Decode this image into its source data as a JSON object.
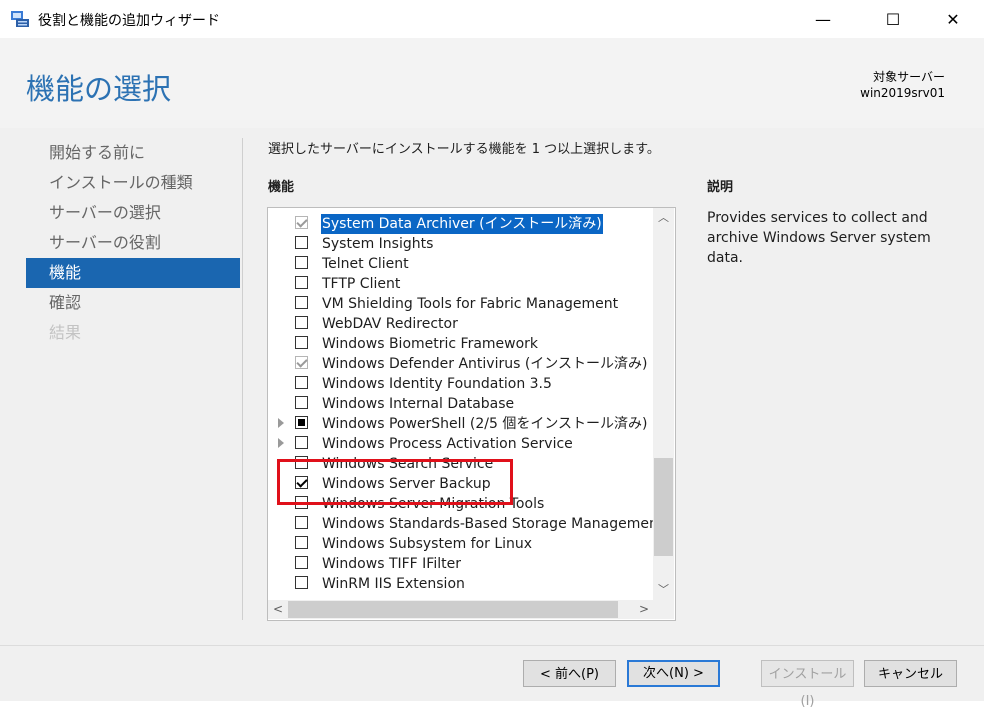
{
  "window": {
    "title": "役割と機能の追加ウィザード",
    "icon": "server-wizard-icon",
    "controls": {
      "minimize": "—",
      "maximize": "☐",
      "close": "✕"
    }
  },
  "header": {
    "page_title": "機能の選択",
    "target_server_label": "対象サーバー",
    "target_server_value": "win2019srv01"
  },
  "nav": {
    "items": [
      {
        "label": "開始する前に",
        "state": "normal"
      },
      {
        "label": "インストールの種類",
        "state": "normal"
      },
      {
        "label": "サーバーの選択",
        "state": "normal"
      },
      {
        "label": "サーバーの役割",
        "state": "normal"
      },
      {
        "label": "機能",
        "state": "active"
      },
      {
        "label": "確認",
        "state": "normal"
      },
      {
        "label": "結果",
        "state": "disabled"
      }
    ]
  },
  "main": {
    "instruction": "選択したサーバーにインストールする機能を 1 つ以上選択します。",
    "features_heading": "機能",
    "features": [
      {
        "label": "System Data Archiver (インストール済み)",
        "check": "grayed",
        "selected": true,
        "expandable": false
      },
      {
        "label": "System Insights",
        "check": "none",
        "selected": false,
        "expandable": false
      },
      {
        "label": "Telnet Client",
        "check": "none",
        "selected": false,
        "expandable": false
      },
      {
        "label": "TFTP Client",
        "check": "none",
        "selected": false,
        "expandable": false
      },
      {
        "label": "VM Shielding Tools for Fabric Management",
        "check": "none",
        "selected": false,
        "expandable": false
      },
      {
        "label": "WebDAV Redirector",
        "check": "none",
        "selected": false,
        "expandable": false
      },
      {
        "label": "Windows Biometric Framework",
        "check": "none",
        "selected": false,
        "expandable": false
      },
      {
        "label": "Windows Defender Antivirus (インストール済み)",
        "check": "grayed",
        "selected": false,
        "expandable": false
      },
      {
        "label": "Windows Identity Foundation 3.5",
        "check": "none",
        "selected": false,
        "expandable": false
      },
      {
        "label": "Windows Internal Database",
        "check": "none",
        "selected": false,
        "expandable": false
      },
      {
        "label": "Windows PowerShell (2/5 個をインストール済み)",
        "check": "partial",
        "selected": false,
        "expandable": true
      },
      {
        "label": "Windows Process Activation Service",
        "check": "none",
        "selected": false,
        "expandable": true
      },
      {
        "label": "Windows Search Service",
        "check": "none",
        "selected": false,
        "expandable": false
      },
      {
        "label": "Windows Server Backup",
        "check": "checked",
        "selected": false,
        "expandable": false
      },
      {
        "label": "Windows Server Migration Tools",
        "check": "none",
        "selected": false,
        "expandable": false
      },
      {
        "label": "Windows Standards-Based Storage Management",
        "check": "none",
        "selected": false,
        "expandable": false
      },
      {
        "label": "Windows Subsystem for Linux",
        "check": "none",
        "selected": false,
        "expandable": false
      },
      {
        "label": "Windows TIFF IFilter",
        "check": "none",
        "selected": false,
        "expandable": false
      },
      {
        "label": "WinRM IIS Extension",
        "check": "none",
        "selected": false,
        "expandable": false
      }
    ],
    "description_heading": "説明",
    "description_text": "Provides services to collect and archive Windows Server system data.",
    "scroll_arrows": {
      "up": "︿",
      "down": "﹀",
      "left": "<",
      "right": ">"
    }
  },
  "footer": {
    "back_label": "< 前へ(P)",
    "next_label": "次へ(N) >",
    "install_label": "インストール(I)",
    "cancel_label": "キャンセル"
  },
  "colors": {
    "accent": "#1a66b0",
    "title": "#2c72b3",
    "highlight": "#e0101a"
  }
}
